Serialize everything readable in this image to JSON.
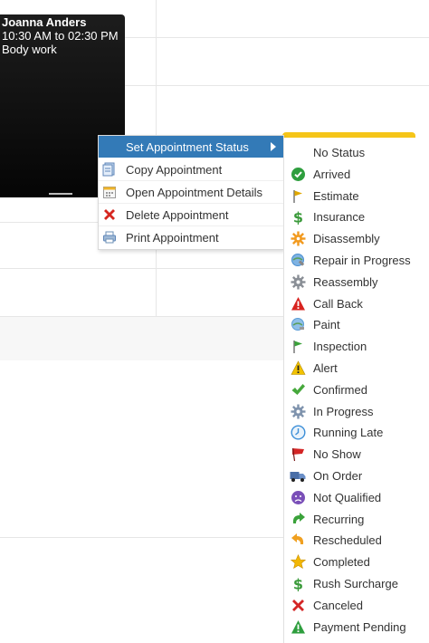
{
  "appointment": {
    "name": "Joanna Anders",
    "time": "10:30 AM to 02:30 PM",
    "service": "Body work"
  },
  "context_menu": {
    "items": [
      {
        "label": "Set Appointment Status",
        "icon": "status-icon",
        "active": true,
        "has_submenu": true
      },
      {
        "label": "Copy Appointment",
        "icon": "copy-icon"
      },
      {
        "label": "Open Appointment Details",
        "icon": "calendar-details-icon"
      },
      {
        "label": "Delete Appointment",
        "icon": "delete-x-icon"
      },
      {
        "label": "Print Appointment",
        "icon": "printer-icon"
      }
    ]
  },
  "status_menu": {
    "items": [
      {
        "label": "No Status",
        "icon": "none",
        "color": ""
      },
      {
        "label": "Arrived",
        "icon": "check-circle-icon",
        "color": "#2e9e3e"
      },
      {
        "label": "Estimate",
        "icon": "yellow-flag-icon",
        "color": "#e0a800"
      },
      {
        "label": "Insurance",
        "icon": "dollar-icon",
        "color": "#3a9a3a"
      },
      {
        "label": "Disassembly",
        "icon": "orange-gear-icon",
        "color": "#f29a1f"
      },
      {
        "label": "Repair in Progress",
        "icon": "globe-wrench-icon",
        "color": "#4a8fd0"
      },
      {
        "label": "Reassembly",
        "icon": "grey-gear-icon",
        "color": "#8a8f96"
      },
      {
        "label": "Call Back",
        "icon": "red-warning-icon",
        "color": "#d8231f"
      },
      {
        "label": "Paint",
        "icon": "paint-globe-icon",
        "color": "#5a9cd6"
      },
      {
        "label": "Inspection",
        "icon": "green-flag-icon",
        "color": "#3aa23a"
      },
      {
        "label": "Alert",
        "icon": "yellow-warning-icon",
        "color": "#f2c200"
      },
      {
        "label": "Confirmed",
        "icon": "green-check-icon",
        "color": "#46a83c"
      },
      {
        "label": "In Progress",
        "icon": "blue-gear-icon",
        "color": "#7f93ad"
      },
      {
        "label": "Running Late",
        "icon": "clock-icon",
        "color": "#3c8fd8"
      },
      {
        "label": "No Show",
        "icon": "red-flag-icon",
        "color": "#d42525"
      },
      {
        "label": "On Order",
        "icon": "truck-icon",
        "color": "#4a6fa8"
      },
      {
        "label": "Not Qualified",
        "icon": "sad-face-icon",
        "color": "#7a4fb8"
      },
      {
        "label": "Recurring",
        "icon": "recurring-arrow-icon",
        "color": "#3aa23a"
      },
      {
        "label": "Rescheduled",
        "icon": "reschedule-arrow-icon",
        "color": "#f0a020"
      },
      {
        "label": "Completed",
        "icon": "star-icon",
        "color": "#f2b705"
      },
      {
        "label": "Rush Surcharge",
        "icon": "dollar-icon",
        "color": "#3a9a3a"
      },
      {
        "label": "Canceled",
        "icon": "red-x-icon",
        "color": "#d42525"
      },
      {
        "label": "Payment Pending",
        "icon": "green-warning-icon",
        "color": "#2e9e3e"
      }
    ]
  }
}
